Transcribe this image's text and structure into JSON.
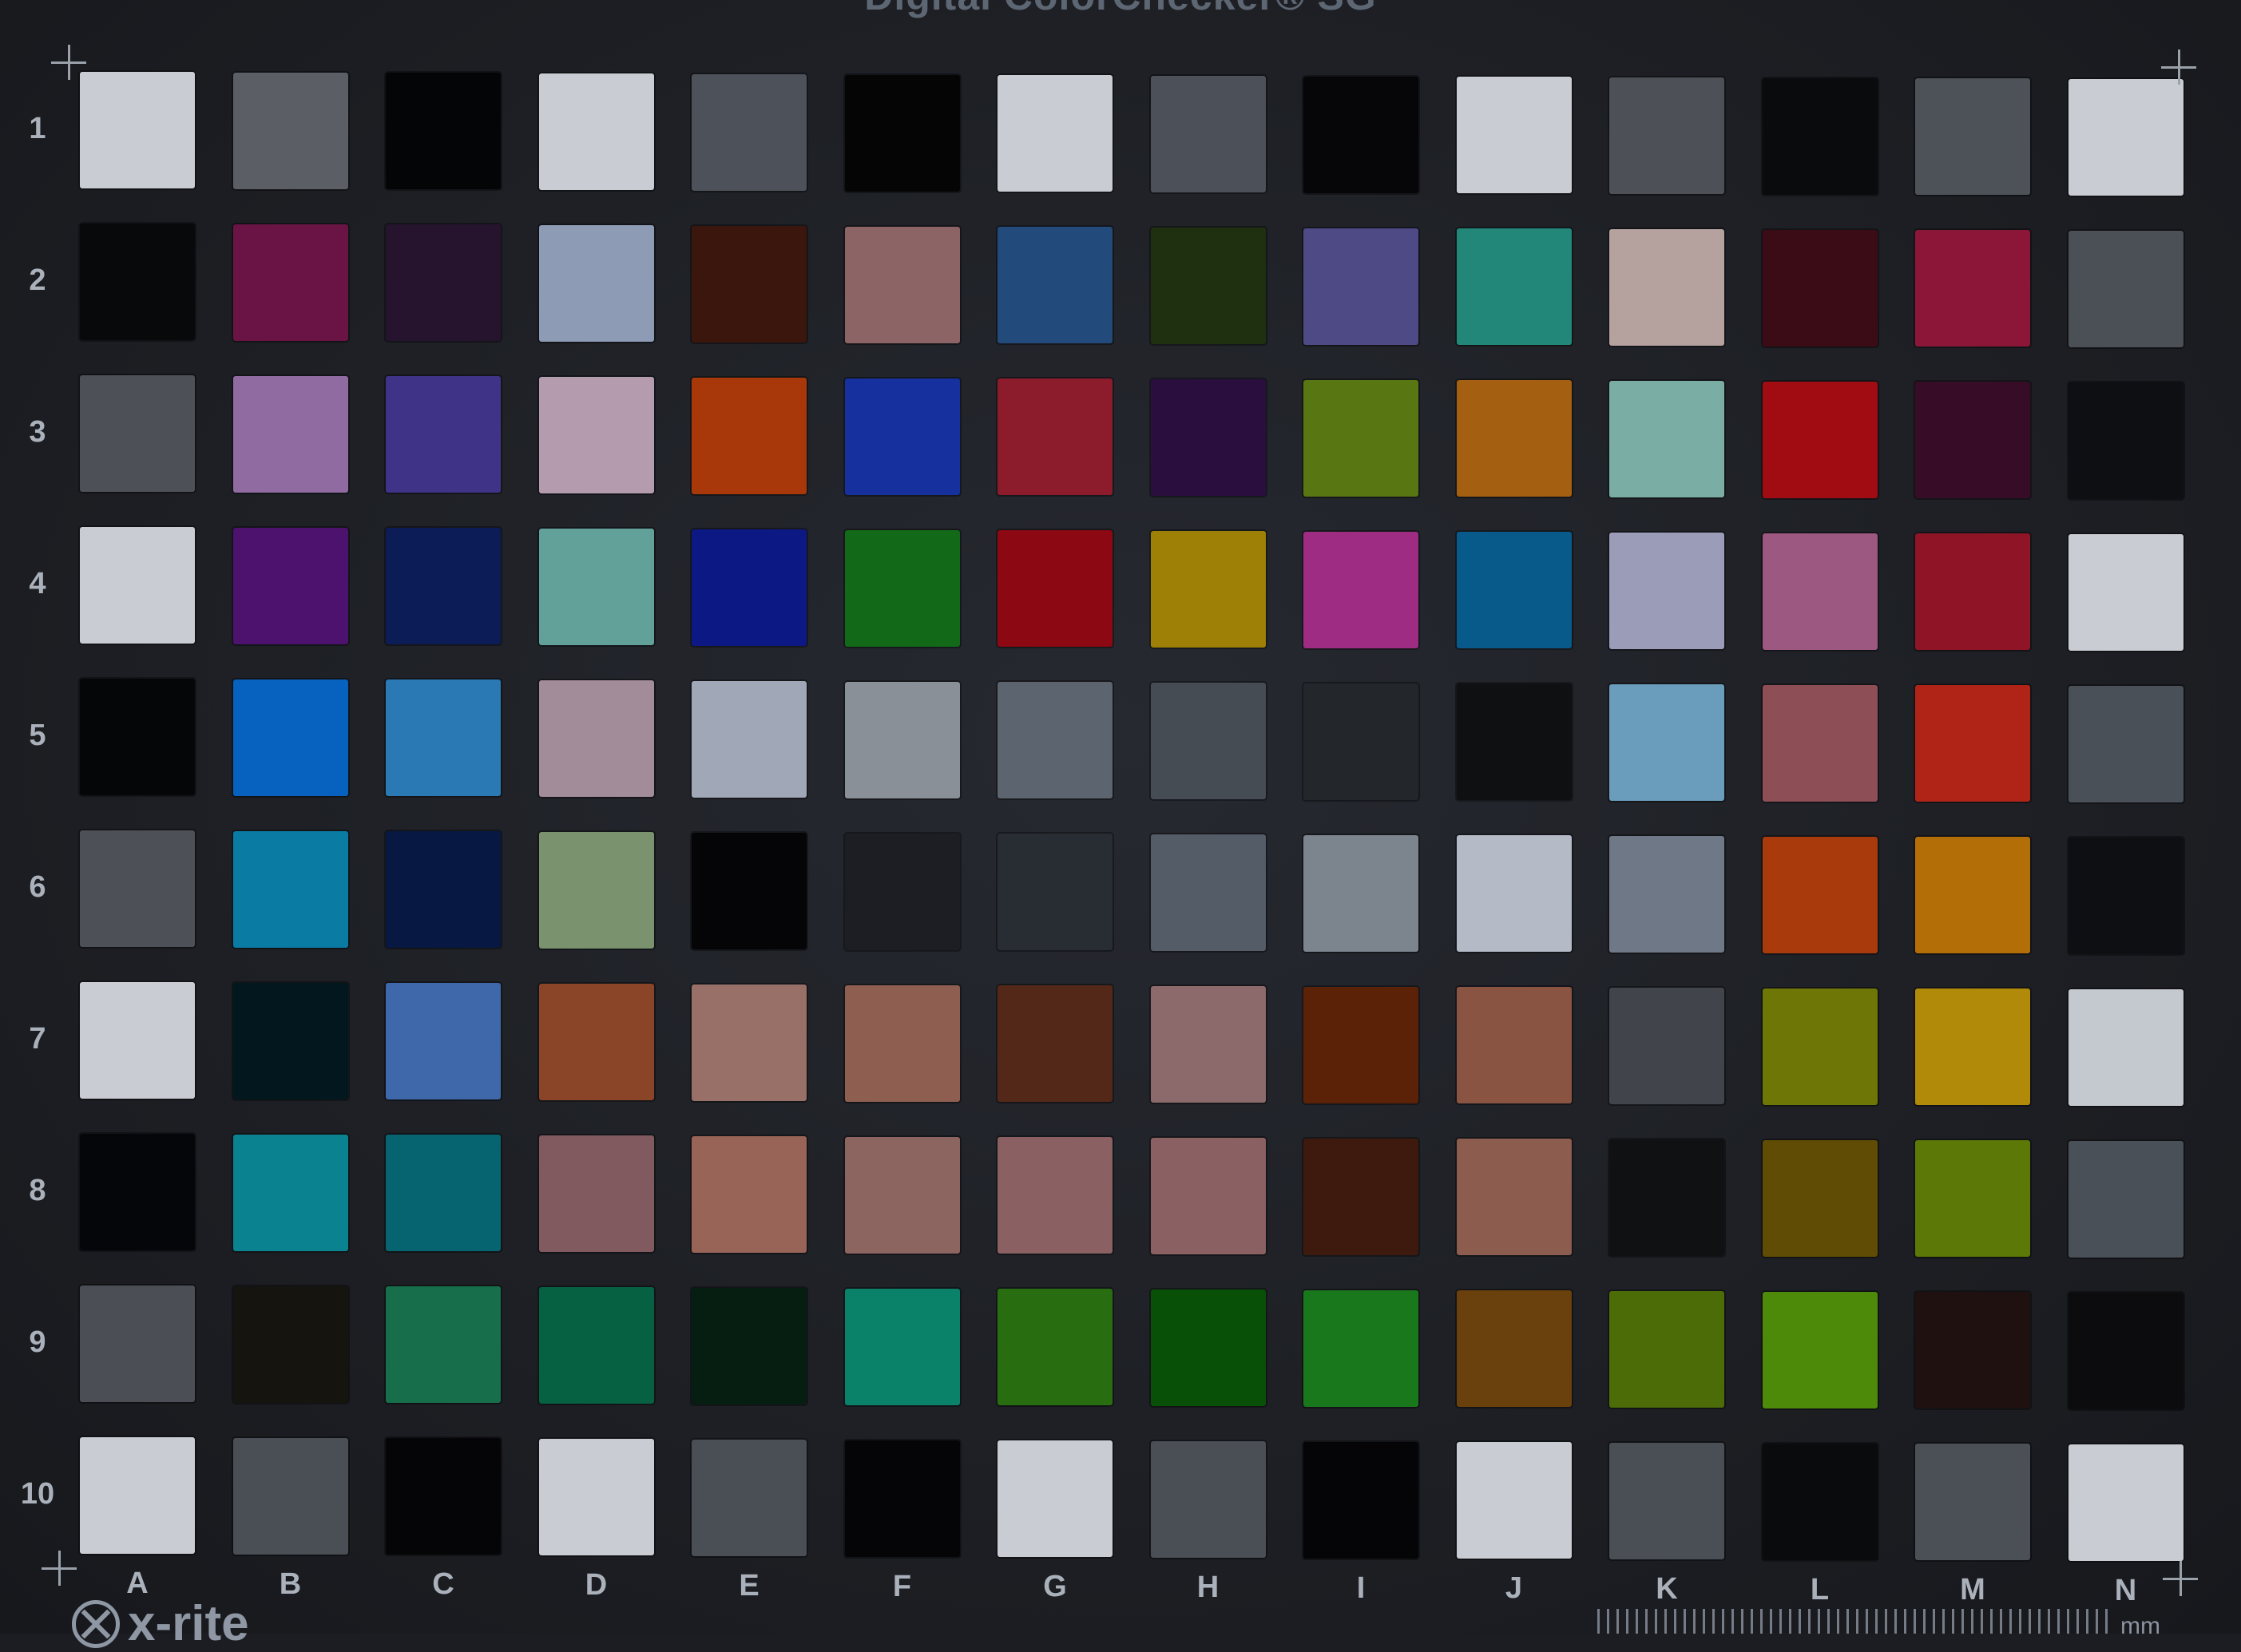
{
  "title": "Digital ColorChecker® SG",
  "brand": "x-rite",
  "ruler_unit": "mm",
  "columns": [
    "A",
    "B",
    "C",
    "D",
    "E",
    "F",
    "G",
    "H",
    "I",
    "J",
    "K",
    "L",
    "M",
    "N"
  ],
  "rows": [
    "1",
    "2",
    "3",
    "4",
    "5",
    "6",
    "7",
    "8",
    "9",
    "10"
  ],
  "patches": [
    [
      "#c9ccd2",
      "#5b5f65",
      "#040506",
      "#c9ccd2",
      "#4d525a",
      "#050506",
      "#c9ccd2",
      "#4c5058",
      "#060608",
      "#c9ccd2",
      "#4d5157",
      "#0a0b0d",
      "#4d5258",
      "#c9ccd2"
    ],
    [
      "#08090b",
      "#6a1446",
      "#26142e",
      "#8e9bb5",
      "#3a160c",
      "#8c6466",
      "#224a7a",
      "#1f3010",
      "#4d4a86",
      "#228679",
      "#b5a29f",
      "#3c0c16",
      "#8c1638",
      "#4b4f56"
    ],
    [
      "#4d5157",
      "#8f6ba1",
      "#3f3388",
      "#b49cae",
      "#a8380a",
      "#16319e",
      "#8c1c2c",
      "#2a0f3e",
      "#587612",
      "#a46010",
      "#7aada4",
      "#a00c12",
      "#360c26",
      "#0e0f12"
    ],
    [
      "#c9ccd2",
      "#4c126e",
      "#0c1c56",
      "#62a09a",
      "#0c1884",
      "#126a18",
      "#8c0812",
      "#9e8006",
      "#9e2c82",
      "#085a8a",
      "#9a9cb8",
      "#9c5880",
      "#8e1426",
      "#c9ccd2"
    ],
    [
      "#050608",
      "#0662be",
      "#2a78b4",
      "#a28c9a",
      "#a0a8b8",
      "#8a9098",
      "#5c6470",
      "#464c54",
      "#23272c",
      "#0f1012",
      "#6a9cbc",
      "#8e4e56",
      "#b02418",
      "#4a5058"
    ],
    [
      "#4d5157",
      "#0a7ca4",
      "#071842",
      "#7a926e",
      "#050507",
      "#1c1e23",
      "#282d33",
      "#545c68",
      "#7c848e",
      "#b4bac6",
      "#6e7886",
      "#a93a0c",
      "#b46e08",
      "#0e0f12"
    ],
    [
      "#c9ccd2",
      "#02181e",
      "#3e68aa",
      "#8a4428",
      "#987068",
      "#8e5e50",
      "#542818",
      "#8c6a6c",
      "#5c2208",
      "#8a5442",
      "#41454b",
      "#6e7606",
      "#b08a08",
      "#c4c9d0"
    ],
    [
      "#05060a",
      "#0a8290",
      "#066470",
      "#805a5e",
      "#986458",
      "#8c6460",
      "#8a6062",
      "#8a6062",
      "#3e1a0e",
      "#8c5c4e",
      "#101112",
      "#604c04",
      "#5c7806",
      "#4a5058"
    ],
    [
      "#4b4f55",
      "#16140f",
      "#166e4a",
      "#066042",
      "#061e12",
      "#0a826a",
      "#286e10",
      "#085008",
      "#1a781c",
      "#6a400c",
      "#4c6c08",
      "#4e8a0a",
      "#1e1110",
      "#0c0c0e"
    ],
    [
      "#c9ccd2",
      "#4a4f56",
      "#050507",
      "#c9ccd2",
      "#4a4f56",
      "#050507",
      "#c9ccd2",
      "#4a4f56",
      "#050507",
      "#c9ccd2",
      "#4a4f56",
      "#0a0b0d",
      "#4b5057",
      "#c9ccd2"
    ]
  ]
}
